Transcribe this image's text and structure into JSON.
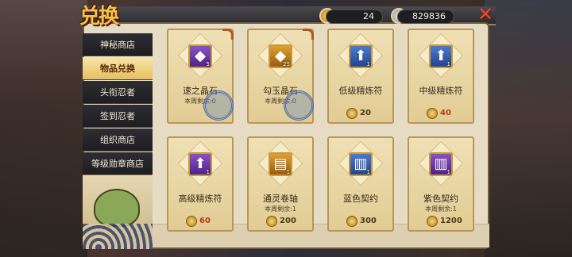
{
  "title": "兑换",
  "currencies": [
    {
      "name": "gold-coupon",
      "value": "24"
    },
    {
      "name": "silver-coin",
      "value": "829836"
    }
  ],
  "sidebar": {
    "items": [
      {
        "label": "神秘商店"
      },
      {
        "label": "物品兑换",
        "active": true
      },
      {
        "label": "头衔忍者"
      },
      {
        "label": "签到忍者"
      },
      {
        "label": "组织商店"
      },
      {
        "label": "等级勋章商店"
      }
    ]
  },
  "cards": [
    {
      "name": "速之晶石",
      "sub": "本周剩余:0",
      "qty": "5",
      "icon": "purple-crystal-icon",
      "price": "",
      "soldout": true
    },
    {
      "name": "勾玉晶石",
      "sub": "本周剩余:0",
      "qty": "25",
      "icon": "gold-crystal-icon",
      "price": "",
      "soldout": true
    },
    {
      "name": "低级精炼符",
      "sub": "",
      "qty": "1",
      "icon": "green-refine-scroll-icon",
      "price": "20"
    },
    {
      "name": "中级精炼符",
      "sub": "",
      "qty": "1",
      "icon": "blue-refine-scroll-icon",
      "price": "40"
    },
    {
      "name": "高级精炼符",
      "sub": "",
      "qty": "1",
      "icon": "purple-refine-scroll-icon",
      "price": "60"
    },
    {
      "name": "通灵卷轴",
      "sub": "本周剩余:1",
      "qty": "1",
      "icon": "summon-scroll-icon",
      "price": "200"
    },
    {
      "name": "蓝色契约",
      "sub": "",
      "qty": "1",
      "icon": "blue-contract-icon",
      "price": "300"
    },
    {
      "name": "紫色契约",
      "sub": "本周剩余:1",
      "qty": "1",
      "icon": "purple-contract-icon",
      "price": "1200"
    }
  ]
}
